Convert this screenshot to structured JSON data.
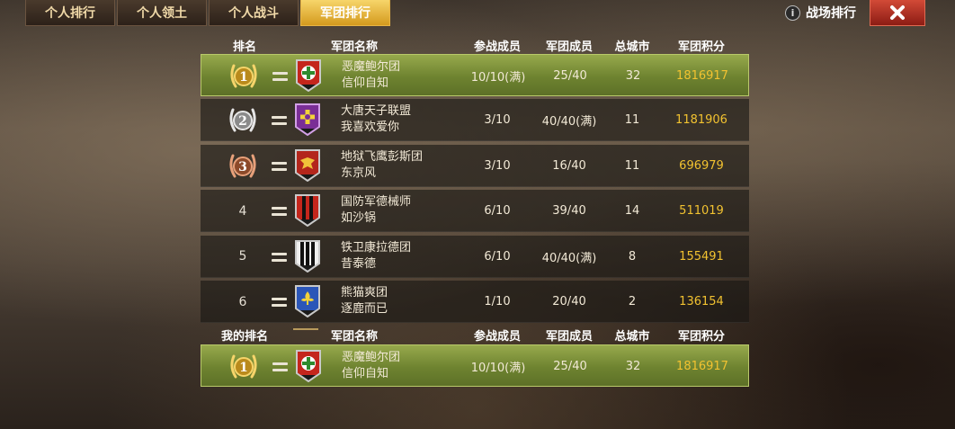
{
  "tabs": [
    "个人排行",
    "个人领土",
    "个人战斗",
    "军团排行"
  ],
  "battlefield_rank_label": "战场排行",
  "info_icon_glyph": "i",
  "close_glyph": "✕",
  "headers": {
    "rank": "排名",
    "name": "军团名称",
    "participants": "参战成员",
    "members": "军团成员",
    "cities": "总城市",
    "score": "军团积分"
  },
  "my_headers": {
    "rank": "我的排名",
    "name": "军团名称",
    "participants": "参战成员",
    "members": "军团成员",
    "cities": "总城市",
    "score": "军团积分"
  },
  "rows": [
    {
      "rank": "1",
      "legion": "恶魔鲍尔团",
      "leader": "信仰自知",
      "participants": "10/10(满)",
      "members": "25/40",
      "cities": "32",
      "score": "1816917",
      "emblem": "red-green-cross-emblem"
    },
    {
      "rank": "2",
      "legion": "大唐天子联盟",
      "leader": "我喜欢爱你",
      "participants": "3/10",
      "members": "40/40(满)",
      "cities": "11",
      "score": "1181906",
      "emblem": "purple-yellow-cross-emblem"
    },
    {
      "rank": "3",
      "legion": "地狱飞鹰彭斯团",
      "leader": "东京风",
      "participants": "3/10",
      "members": "16/40",
      "cities": "11",
      "score": "696979",
      "emblem": "red-eagle-emblem"
    },
    {
      "rank": "4",
      "legion": "国防军德械师",
      "leader": "如沙锅",
      "participants": "6/10",
      "members": "39/40",
      "cities": "14",
      "score": "511019",
      "emblem": "red-black-stripes-emblem"
    },
    {
      "rank": "5",
      "legion": "铁卫康拉德团",
      "leader": "昔泰德",
      "participants": "6/10",
      "members": "40/40(满)",
      "cities": "8",
      "score": "155491",
      "emblem": "black-white-stripes-emblem"
    },
    {
      "rank": "6",
      "legion": "熊猫爽团",
      "leader": "逐鹿而已",
      "participants": "1/10",
      "members": "20/40",
      "cities": "2",
      "score": "136154",
      "emblem": "blue-fleur-emblem"
    }
  ],
  "my_row": {
    "rank": "1",
    "legion": "恶魔鲍尔团",
    "leader": "信仰自知",
    "participants": "10/10(满)",
    "members": "25/40",
    "cities": "32",
    "score": "1816917",
    "emblem": "red-green-cross-emblem"
  },
  "colors": {
    "active_tab": "#f2c14e",
    "highlight_row": "#7a8e35",
    "score": "#f2c230",
    "close": "#b32a1c"
  }
}
